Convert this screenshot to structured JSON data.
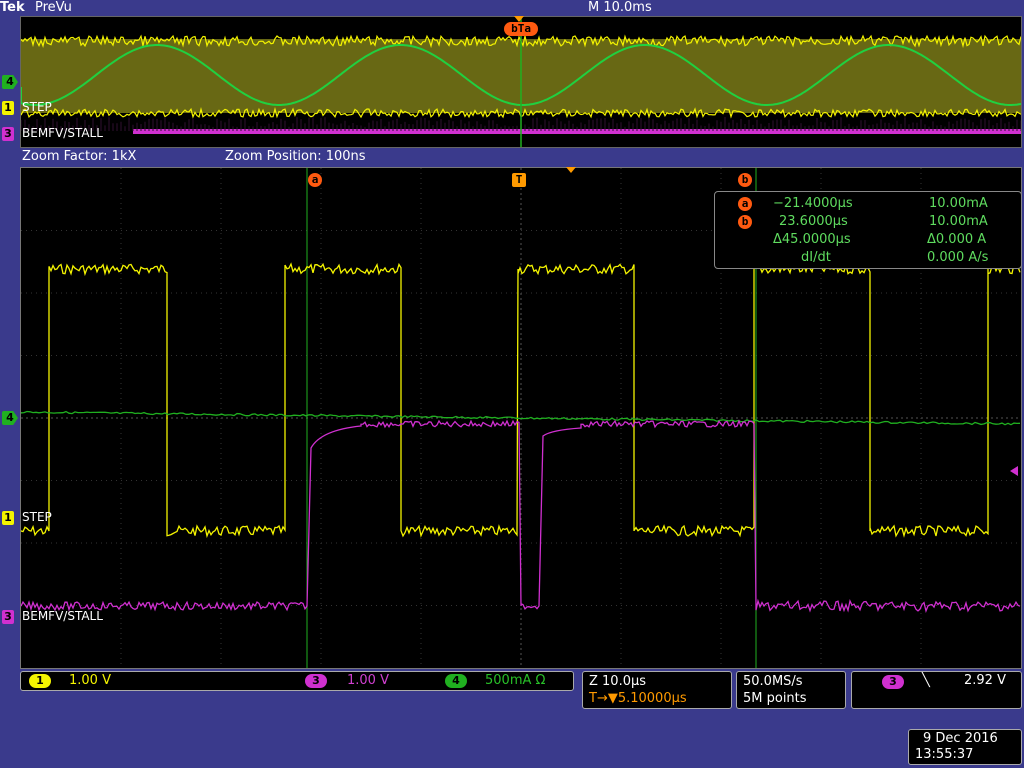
{
  "header": {
    "brand": "Tek",
    "mode": "PreVu",
    "timebase": "M 10.0ms"
  },
  "overview": {
    "trigger_marker": "T",
    "cursor_b_marker": "b",
    "cursor_a_marker": "a",
    "ch4_label": "4",
    "ch1_num": "1",
    "ch1_name": "STEP",
    "ch3_num": "3",
    "ch3_name": "BEMFV/STALL"
  },
  "zoom": {
    "factor": "Zoom Factor: 1kX",
    "position": "Zoom Position: 100ns"
  },
  "main": {
    "cursor_a": "a",
    "trigger": "T",
    "cursor_b": "b",
    "ch4_num": "4",
    "ch1_num": "1",
    "ch1_name": "STEP",
    "ch3_num": "3",
    "ch3_name": "BEMFV/STALL"
  },
  "readout": {
    "b_header": "b",
    "a_marker": "a",
    "a_time": "−21.4000µs",
    "a_value": "10.00mA",
    "b_marker": "b",
    "b_time": "23.6000µs",
    "b_value": "10.00mA",
    "delta_time": "Δ45.0000µs",
    "delta_value": "Δ0.000 A",
    "didt_label": "dI/dt",
    "didt_value": "0.000 A/s"
  },
  "status": {
    "ch1_num": "1",
    "ch1_scale": "1.00 V",
    "ch3_num": "3",
    "ch3_scale": "1.00 V",
    "ch4_num": "4",
    "ch4_scale": "500mA Ω",
    "zoom_scale": "Z 10.0µs",
    "trigger_delay": "T→▼5.10000µs",
    "sample_rate": "50.0MS/s",
    "record_length": "5M points",
    "trig_ch_num": "3",
    "trig_slope": "╲",
    "trig_level": "2.92 V",
    "date": "9 Dec 2016",
    "time": "13:55:37"
  },
  "colors": {
    "ch1": "#f4f400",
    "ch3": "#d030d0",
    "ch4": "#20b020",
    "accent": "#ff8a00",
    "bg": "#3a3a8c"
  }
}
